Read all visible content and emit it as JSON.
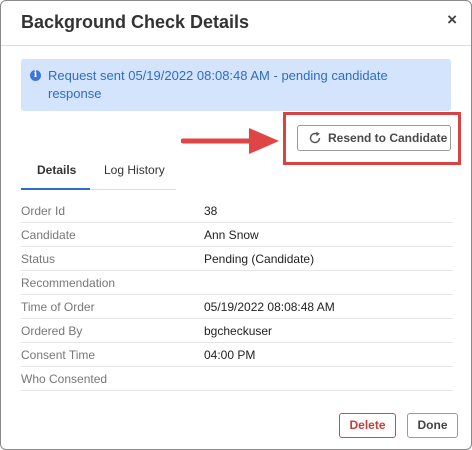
{
  "dialog": {
    "title": "Background Check Details",
    "close_symbol": "×"
  },
  "alert": {
    "icon": "info-icon",
    "text": "Request sent 05/19/2022 08:08:48 AM - pending candidate response"
  },
  "annotation": {
    "arrow_color": "#e04545",
    "highlight_color": "#d84343"
  },
  "resend_button": {
    "icon": "refresh-icon",
    "label": "Resend to Candidate"
  },
  "tabs": [
    {
      "label": "Details",
      "active": true
    },
    {
      "label": "Log History",
      "active": false
    }
  ],
  "details": [
    {
      "label": "Order Id",
      "value": "38"
    },
    {
      "label": "Candidate",
      "value": "Ann Snow"
    },
    {
      "label": "Status",
      "value": "Pending (Candidate)"
    },
    {
      "label": "Recommendation",
      "value": ""
    },
    {
      "label": "Time of Order",
      "value": "05/19/2022 08:08:48 AM"
    },
    {
      "label": "Ordered By",
      "value": "bgcheckuser"
    },
    {
      "label": "Consent Time",
      "value": "04:00 PM"
    },
    {
      "label": "Who Consented",
      "value": ""
    }
  ],
  "footer": {
    "delete_label": "Delete",
    "done_label": "Done"
  },
  "colors": {
    "accent": "#2f6cc8",
    "alert_bg": "#d3e4fc",
    "danger": "#c83b3b"
  }
}
